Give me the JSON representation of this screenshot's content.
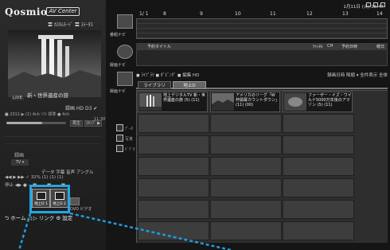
{
  "left_panel": {
    "brand": "Qosmio",
    "brand_badge": "AV Center",
    "top_links": "〓 ｶｽﾀﾑﾓｰﾄﾞ 〓 ｽﾃｰﾀｽ",
    "preview_title": "新・世界遺産の旅",
    "live_badge": "LIVE",
    "meta_line": "録画 HD D3 ✔",
    "info_row": "■ 2011 ▶ (1) 4ch ｿﾌﾄ  標準  ● 4ch",
    "time_label": "11:30",
    "seek_progress": 0.6,
    "buttons": [
      "再生",
      "ｽｷｯﾌﾟ ▶"
    ],
    "rec_label": "録画",
    "bar_tag": "TV  ▾",
    "settings_heads": "データ  字幕  音声  アングル",
    "settings_row2": "◀◀   ▶   ▶▶   ✓ 32%   (1)   (1)   (1)",
    "settings_row3": "停止  ◀▶  ●  —■—  —■—  —■—",
    "drives": [
      {
        "label": "地上D 1"
      },
      {
        "label": "地上D 2"
      }
    ],
    "dvd_label": "DVD ビデオ",
    "bottom_row": "⮌ ホーム  ◁  ▷  リンク   ⚙ 設定"
  },
  "right_panel": {
    "status": "1月11日 (火) 16:47",
    "timeline": {
      "ticks": [
        "1/ 1",
        "8",
        "9",
        "10",
        "11",
        "12",
        "13",
        "14"
      ],
      "label": "番組ナビ"
    },
    "reserve": {
      "label": "録画ナビ",
      "headers": [
        "予約タイトル",
        "ﾁｬﾝﾈﾙ",
        "CH",
        "予約日時",
        "曜日"
      ]
    },
    "library": {
      "label": "録画ナビ",
      "header_left": "◼ ﾗｲﾌﾞﾗﾘ ◼ ﾀﾞﾋﾞﾝｸﾞ ◼ 編集 HD",
      "header_right": "録画日時 降順 ▾ 全件表示 全体",
      "tabs": [
        "ライブラリ",
        "地上D"
      ],
      "cards": [
        {
          "title": "地上デジタルTV 新・世界遺産の旅 (5) (11)"
        },
        {
          "title": "アメリカのリーグ「W 杯開幕カウントダウン」 (11) (00)"
        },
        {
          "title": "ファーザー・イズ・ワイルド5000万年後のアマゾン (5) (11)"
        }
      ],
      "side_icons": [
        "ﾃﾞｰﾀ",
        "写真",
        "ﾋﾞﾃﾞｵ"
      ]
    }
  }
}
